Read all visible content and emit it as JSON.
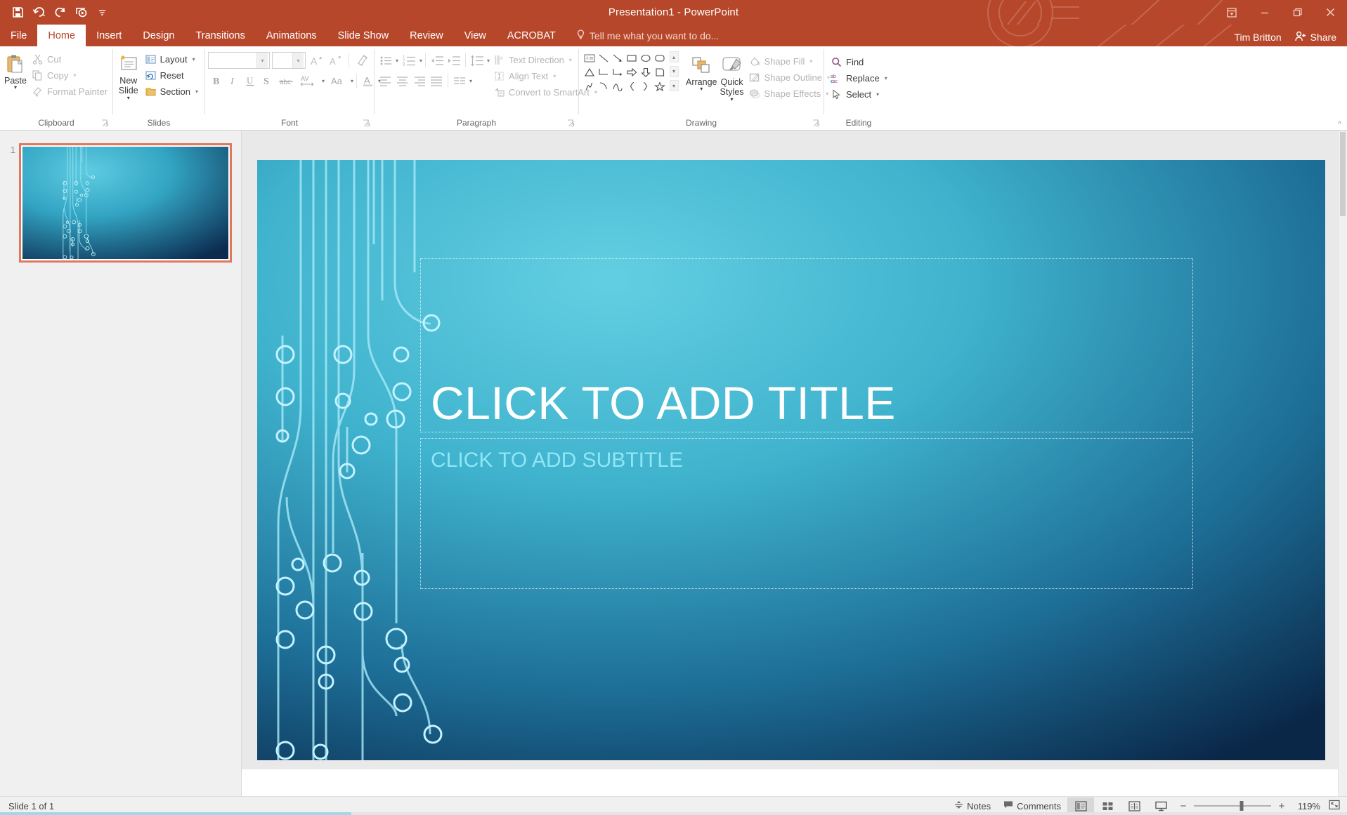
{
  "window": {
    "title": "Presentation1 - PowerPoint",
    "quick_access": [
      {
        "name": "save-icon",
        "label": "Save"
      },
      {
        "name": "undo-icon",
        "label": "Undo"
      },
      {
        "name": "redo-icon",
        "label": "Repeat"
      },
      {
        "name": "start-from-beginning-icon",
        "label": "Start From Beginning"
      },
      {
        "name": "customize-quick-access-toolbar-icon",
        "label": "Customize Quick Access Toolbar"
      }
    ],
    "controls": [
      {
        "name": "ribbon-display-options-icon",
        "label": "Ribbon Display Options"
      },
      {
        "name": "minimize-icon",
        "label": "Minimize"
      },
      {
        "name": "restore-icon",
        "label": "Restore Down"
      },
      {
        "name": "close-icon",
        "label": "Close"
      }
    ],
    "accent_color": "#b7472a"
  },
  "tabs": [
    {
      "label": "File",
      "active": false
    },
    {
      "label": "Home",
      "active": true
    },
    {
      "label": "Insert",
      "active": false
    },
    {
      "label": "Design",
      "active": false
    },
    {
      "label": "Transitions",
      "active": false
    },
    {
      "label": "Animations",
      "active": false
    },
    {
      "label": "Slide Show",
      "active": false
    },
    {
      "label": "Review",
      "active": false
    },
    {
      "label": "View",
      "active": false
    },
    {
      "label": "ACROBAT",
      "active": false
    }
  ],
  "tell_me": {
    "label": "Tell me what you want to do...",
    "icon": "lightbulb-icon"
  },
  "account": {
    "name": "Tim Britton",
    "share_label": "Share",
    "share_icon": "share-person-icon"
  },
  "ribbon": {
    "collapse_label": "^",
    "groups": [
      {
        "label": "Clipboard",
        "has_dialog_launcher": true,
        "big_buttons": [
          {
            "name": "paste-button",
            "label": "Paste",
            "icon": "paste-icon",
            "disabled": false,
            "has_caret": true
          }
        ],
        "small_buttons": [
          {
            "name": "cut-button",
            "label": "Cut",
            "icon": "scissors-icon",
            "disabled": true,
            "has_caret": false
          },
          {
            "name": "copy-button",
            "label": "Copy",
            "icon": "copy-icon",
            "disabled": true,
            "has_caret": true
          },
          {
            "name": "format-painter-button",
            "label": "Format Painter",
            "icon": "paintbrush-icon",
            "disabled": true,
            "has_caret": false
          }
        ]
      },
      {
        "label": "Slides",
        "has_dialog_launcher": false,
        "big_buttons": [
          {
            "name": "new-slide-button",
            "label": "New Slide",
            "icon": "new-slide-icon",
            "disabled": false,
            "has_caret": true
          }
        ],
        "small_buttons": [
          {
            "name": "layout-button",
            "label": "Layout",
            "icon": "layout-icon",
            "disabled": false,
            "has_caret": true
          },
          {
            "name": "reset-button",
            "label": "Reset",
            "icon": "reset-icon",
            "disabled": false,
            "has_caret": false
          },
          {
            "name": "section-button",
            "label": "Section",
            "icon": "section-icon",
            "disabled": false,
            "has_caret": true
          }
        ]
      },
      {
        "label": "Font",
        "has_dialog_launcher": true,
        "font_name": {
          "name": "font-name-combo",
          "value": "",
          "placeholder": ""
        },
        "font_size": {
          "name": "font-size-combo",
          "value": "",
          "placeholder": ""
        },
        "buttons_row1": [
          {
            "name": "increase-font-size-button",
            "glyph": "A",
            "icon": "increase-font-size-icon",
            "disabled": true
          },
          {
            "name": "decrease-font-size-button",
            "glyph": "A",
            "icon": "decrease-font-size-icon",
            "disabled": true
          },
          {
            "name": "clear-all-formatting-button",
            "glyph": "",
            "icon": "clear-formatting-icon",
            "disabled": true
          }
        ],
        "buttons_row2": [
          {
            "name": "bold-button",
            "glyph": "B",
            "icon": "bold-icon",
            "disabled": true
          },
          {
            "name": "italic-button",
            "glyph": "I",
            "icon": "italic-icon",
            "disabled": true
          },
          {
            "name": "underline-button",
            "glyph": "U",
            "icon": "underline-icon",
            "disabled": true
          },
          {
            "name": "text-shadow-button",
            "glyph": "S",
            "icon": "text-shadow-icon",
            "disabled": true
          },
          {
            "name": "strikethrough-button",
            "glyph": "abc",
            "icon": "strikethrough-icon",
            "disabled": true
          },
          {
            "name": "character-spacing-button",
            "glyph": "AV",
            "icon": "character-spacing-icon",
            "disabled": true
          },
          {
            "name": "change-case-button",
            "glyph": "Aa",
            "icon": "change-case-icon",
            "disabled": true
          },
          {
            "name": "font-color-button",
            "glyph": "A",
            "icon": "font-color-icon",
            "disabled": true
          }
        ]
      },
      {
        "label": "Paragraph",
        "has_dialog_launcher": true,
        "buttons_row1": [
          {
            "name": "bullets-button",
            "icon": "bullet-list-icon",
            "disabled": true,
            "has_caret": true
          },
          {
            "name": "numbering-button",
            "icon": "numbered-list-icon",
            "disabled": true,
            "has_caret": true
          },
          {
            "name": "decrease-indent-button",
            "icon": "decrease-indent-icon",
            "disabled": true,
            "has_caret": false
          },
          {
            "name": "increase-indent-button",
            "icon": "increase-indent-icon",
            "disabled": true,
            "has_caret": false
          },
          {
            "name": "line-spacing-button",
            "icon": "line-spacing-icon",
            "disabled": true,
            "has_caret": true
          }
        ],
        "buttons_row2": [
          {
            "name": "align-left-button",
            "icon": "align-left-icon",
            "disabled": true,
            "has_caret": false
          },
          {
            "name": "align-center-button",
            "icon": "align-center-icon",
            "disabled": true,
            "has_caret": false
          },
          {
            "name": "align-right-button",
            "icon": "align-right-icon",
            "disabled": true,
            "has_caret": false
          },
          {
            "name": "justify-button",
            "icon": "justify-icon",
            "disabled": true,
            "has_caret": false
          },
          {
            "name": "columns-button",
            "icon": "columns-icon",
            "disabled": true,
            "has_caret": true
          }
        ],
        "text_buttons": [
          {
            "name": "text-direction-button",
            "label": "Text Direction",
            "icon": "text-direction-icon",
            "disabled": true,
            "has_caret": true
          },
          {
            "name": "align-text-button",
            "label": "Align Text",
            "icon": "align-text-icon",
            "disabled": true,
            "has_caret": true
          },
          {
            "name": "convert-to-smartart-button",
            "label": "Convert to SmartArt",
            "icon": "smartart-icon",
            "disabled": true,
            "has_caret": true
          }
        ]
      },
      {
        "label": "Drawing",
        "has_dialog_launcher": true,
        "shapes": [
          "text-box-icon",
          "line-icon",
          "arrow-icon",
          "rectangle-icon",
          "oval-icon",
          "rounded-rectangle-icon",
          "triangle-icon",
          "elbow-connector-icon",
          "elbow-arrow-connector-icon",
          "right-arrow-icon",
          "down-arrow-icon",
          "pentagon-icon",
          "scribble-icon",
          "arc-icon",
          "curve-icon",
          "left-brace-icon",
          "right-brace-icon",
          "star-icon"
        ],
        "gallery_scroll": [
          "scroll-up-icon",
          "scroll-down-icon",
          "more-shapes-icon"
        ],
        "big_buttons": [
          {
            "name": "arrange-button",
            "label": "Arrange",
            "icon": "arrange-icon",
            "disabled": false,
            "has_caret": true
          },
          {
            "name": "quick-styles-button",
            "label": "Quick Styles",
            "icon": "quick-styles-icon",
            "disabled": false,
            "has_caret": true
          }
        ],
        "small_buttons": [
          {
            "name": "shape-fill-button",
            "label": "Shape Fill",
            "icon": "shape-fill-icon",
            "disabled": true,
            "has_caret": true
          },
          {
            "name": "shape-outline-button",
            "label": "Shape Outline",
            "icon": "shape-outline-icon",
            "disabled": true,
            "has_caret": true
          },
          {
            "name": "shape-effects-button",
            "label": "Shape Effects",
            "icon": "shape-effects-icon",
            "disabled": true,
            "has_caret": true
          }
        ]
      },
      {
        "label": "Editing",
        "has_dialog_launcher": false,
        "small_buttons": [
          {
            "name": "find-button",
            "label": "Find",
            "icon": "search-icon",
            "disabled": false,
            "has_caret": false
          },
          {
            "name": "replace-button",
            "label": "Replace",
            "icon": "replace-icon",
            "disabled": false,
            "has_caret": true
          },
          {
            "name": "select-button",
            "label": "Select",
            "icon": "select-cursor-icon",
            "disabled": false,
            "has_caret": true
          }
        ]
      }
    ]
  },
  "thumbnails": {
    "items": [
      {
        "number": "1",
        "selected": true,
        "name": "slide-thumbnail-1"
      }
    ]
  },
  "slide": {
    "title_placeholder": "CLICK TO ADD TITLE",
    "subtitle_placeholder": "CLICK TO ADD SUBTITLE",
    "title_color": "#ffffff",
    "subtitle_color": "#8fe6f7",
    "bg_top_color": "#3fb5d1",
    "bg_bottom_color": "#0c2f53"
  },
  "status_bar": {
    "slide_counter": "Slide 1 of 1",
    "notes_label": "Notes",
    "notes_icon": "notes-icon",
    "comments_label": "Comments",
    "comments_icon": "comment-icon",
    "views": [
      {
        "name": "normal-view-button",
        "icon": "normal-view-icon",
        "active": true
      },
      {
        "name": "slide-sorter-view-button",
        "icon": "slide-sorter-icon",
        "active": false
      },
      {
        "name": "reading-view-button",
        "icon": "reading-view-icon",
        "active": false
      },
      {
        "name": "slide-show-button",
        "icon": "slide-show-icon",
        "active": false
      }
    ],
    "zoom_out_label": "−",
    "zoom_in_label": "+",
    "zoom_level": "119%",
    "fit_label": "Fit slide to current window",
    "fit_icon": "fit-to-window-icon"
  }
}
